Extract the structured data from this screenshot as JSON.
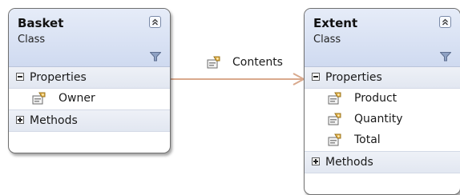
{
  "diagram": {
    "shapes": [
      {
        "name": "Basket",
        "type": "Class",
        "sections": [
          {
            "label": "Properties",
            "expanded": true,
            "members": [
              "Owner"
            ]
          },
          {
            "label": "Methods",
            "expanded": false,
            "members": []
          }
        ]
      },
      {
        "name": "Extent",
        "type": "Class",
        "sections": [
          {
            "label": "Properties",
            "expanded": true,
            "members": [
              "Product",
              "Quantity",
              "Total"
            ]
          },
          {
            "label": "Methods",
            "expanded": false,
            "members": []
          }
        ]
      }
    ],
    "association": {
      "label": "Contents",
      "from": "Basket",
      "to": "Extent",
      "line_color": "#d9a98d"
    },
    "colors": {
      "header_gradient_top": "#e6ecf8",
      "header_gradient_bottom": "#cfdaf0",
      "border": "#6f6f6f"
    }
  }
}
